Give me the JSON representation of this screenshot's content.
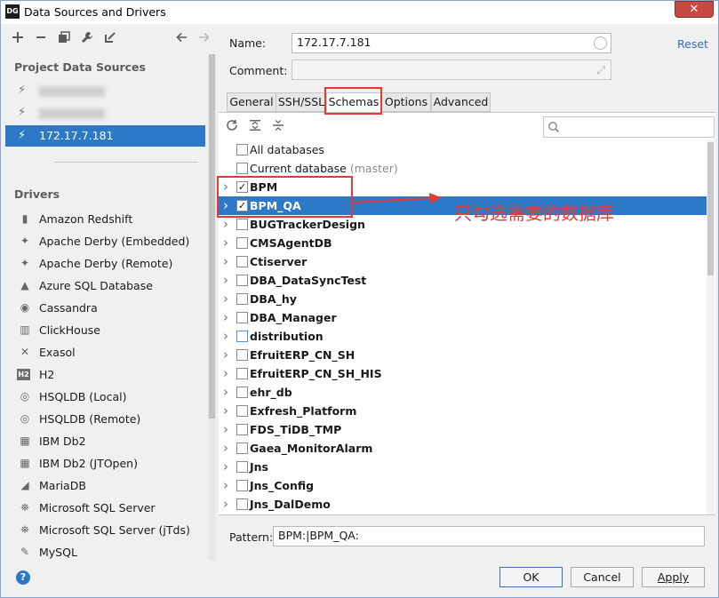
{
  "window": {
    "app_icon": "DG",
    "title": "Data Sources and Drivers",
    "close_glyph": "✕"
  },
  "left_toolbar": {
    "icons": [
      "add-icon",
      "remove-icon",
      "duplicate-icon",
      "wrench-icon",
      "import-icon",
      "back-arrow-icon",
      "forward-arrow-icon"
    ]
  },
  "project_data_sources": {
    "heading": "Project Data Sources",
    "items": [
      {
        "label": "172.17.7.129",
        "blurred": true
      },
      {
        "label": "172.17.7.179",
        "blurred": true
      },
      {
        "label": "172.17.7.181",
        "blurred": false,
        "selected": true
      }
    ]
  },
  "drivers": {
    "heading": "Drivers",
    "items": [
      {
        "label": "Amazon Redshift",
        "icon": "redshift-icon",
        "glyph": "▮"
      },
      {
        "label": "Apache Derby (Embedded)",
        "icon": "derby-icon",
        "glyph": "✦"
      },
      {
        "label": "Apache Derby (Remote)",
        "icon": "derby-icon",
        "glyph": "✦"
      },
      {
        "label": "Azure SQL Database",
        "icon": "azure-icon",
        "glyph": "▲"
      },
      {
        "label": "Cassandra",
        "icon": "cassandra-icon",
        "glyph": "◉"
      },
      {
        "label": "ClickHouse",
        "icon": "clickhouse-icon",
        "glyph": "▥"
      },
      {
        "label": "Exasol",
        "icon": "exasol-icon",
        "glyph": "✕"
      },
      {
        "label": "H2",
        "icon": "h2-icon",
        "glyph": "H2"
      },
      {
        "label": "HSQLDB (Local)",
        "icon": "hsqldb-icon",
        "glyph": "◎"
      },
      {
        "label": "HSQLDB (Remote)",
        "icon": "hsqldb-icon",
        "glyph": "◎"
      },
      {
        "label": "IBM Db2",
        "icon": "db2-icon",
        "glyph": "▦"
      },
      {
        "label": "IBM Db2 (JTOpen)",
        "icon": "db2-icon",
        "glyph": "▦"
      },
      {
        "label": "MariaDB",
        "icon": "mariadb-icon",
        "glyph": "◢"
      },
      {
        "label": "Microsoft SQL Server",
        "icon": "mssql-icon",
        "glyph": "⛯"
      },
      {
        "label": "Microsoft SQL Server (jTds)",
        "icon": "mssql-icon",
        "glyph": "⛯"
      },
      {
        "label": "MySQL",
        "icon": "mysql-icon",
        "glyph": "✎"
      }
    ]
  },
  "form": {
    "name_label": "Name:",
    "name_value": "172.17.7.181",
    "comment_label": "Comment:",
    "comment_value": "",
    "reset_label": "Reset"
  },
  "tabs": [
    {
      "label": "General",
      "active": false
    },
    {
      "label": "SSH/SSL",
      "active": false
    },
    {
      "label": "Schemas",
      "active": true
    },
    {
      "label": "Options",
      "active": false
    },
    {
      "label": "Advanced",
      "active": false
    }
  ],
  "schemas_toolbar": {
    "icons": [
      "refresh-icon",
      "expand-all-icon",
      "collapse-all-icon"
    ],
    "search_icon": "search-icon",
    "search_value": ""
  },
  "schemas": [
    {
      "name": "All databases",
      "checked": false,
      "expandable": false,
      "bold": false
    },
    {
      "name": "Current database",
      "hint": "(master)",
      "checked": false,
      "expandable": false,
      "bold": false
    },
    {
      "name": "BPM",
      "checked": true,
      "expandable": true,
      "bold": true
    },
    {
      "name": "BPM_QA",
      "checked": true,
      "expandable": true,
      "bold": true,
      "selected": true
    },
    {
      "name": "BUGTrackerDesign",
      "checked": false,
      "expandable": true,
      "bold": true
    },
    {
      "name": "CMSAgentDB",
      "checked": false,
      "expandable": true,
      "bold": true
    },
    {
      "name": "Ctiserver",
      "checked": false,
      "expandable": true,
      "bold": true
    },
    {
      "name": "DBA_DataSyncTest",
      "checked": false,
      "expandable": true,
      "bold": true
    },
    {
      "name": "DBA_hy",
      "checked": false,
      "expandable": true,
      "bold": true
    },
    {
      "name": "DBA_Manager",
      "checked": false,
      "expandable": true,
      "bold": true
    },
    {
      "name": "distribution",
      "checked": false,
      "expandable": true,
      "bold": true,
      "blue_box": true
    },
    {
      "name": "EfruitERP_CN_SH",
      "checked": false,
      "expandable": true,
      "bold": true
    },
    {
      "name": "EfruitERP_CN_SH_HIS",
      "checked": false,
      "expandable": true,
      "bold": true
    },
    {
      "name": "ehr_db",
      "checked": false,
      "expandable": true,
      "bold": true
    },
    {
      "name": "Exfresh_Platform",
      "checked": false,
      "expandable": true,
      "bold": true
    },
    {
      "name": "FDS_TiDB_TMP",
      "checked": false,
      "expandable": true,
      "bold": true
    },
    {
      "name": "Gaea_MonitorAlarm",
      "checked": false,
      "expandable": true,
      "bold": true
    },
    {
      "name": "Jns",
      "checked": false,
      "expandable": true,
      "bold": true
    },
    {
      "name": "Jns_Config",
      "checked": false,
      "expandable": true,
      "bold": true
    },
    {
      "name": "Jns_DalDemo",
      "checked": false,
      "expandable": true,
      "bold": true
    }
  ],
  "annotation": {
    "text": "只勾选需要的数据库",
    "color": "#e53935"
  },
  "pattern": {
    "label": "Pattern:",
    "value": "BPM:|BPM_QA:"
  },
  "buttons": {
    "ok": "OK",
    "cancel": "Cancel",
    "apply": "Apply",
    "help": "?"
  },
  "colors": {
    "selection": "#2c7ac7",
    "link": "#2d6fbd",
    "annotation": "#e53935"
  }
}
